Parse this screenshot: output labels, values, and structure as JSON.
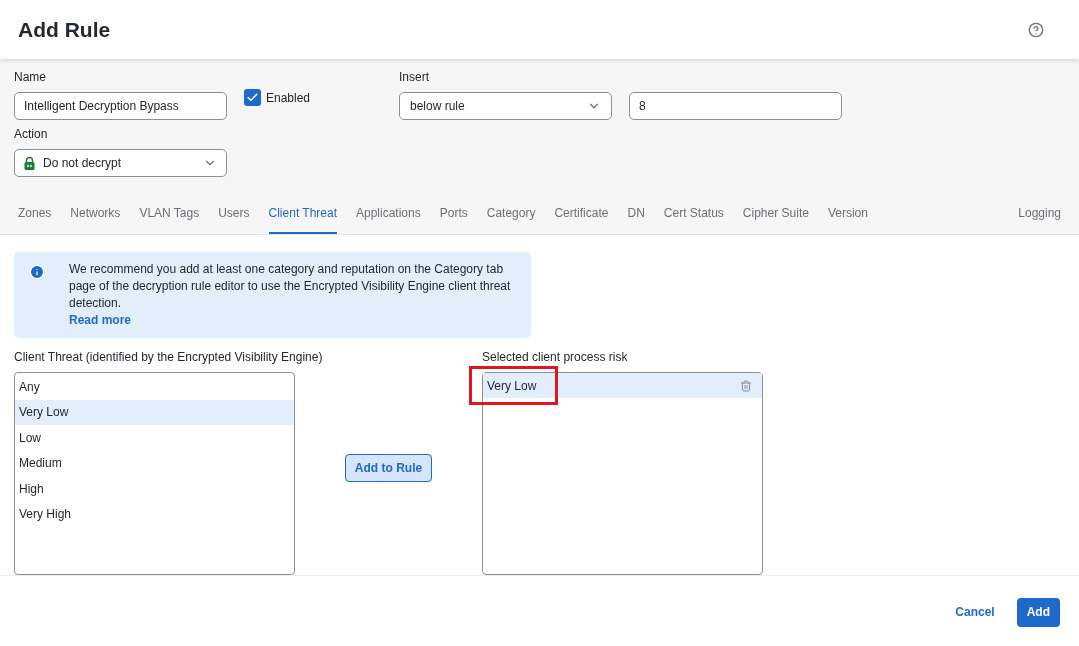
{
  "dialog": {
    "title": "Add Rule"
  },
  "form": {
    "name_label": "Name",
    "name_value": "Intelligent Decryption Bypass",
    "enabled_label": "Enabled",
    "enabled": true,
    "insert_label": "Insert",
    "insert_value": "below rule",
    "insert_number": "8",
    "action_label": "Action",
    "action_value": "Do not decrypt"
  },
  "tabs": [
    {
      "label": "Zones",
      "selected": false
    },
    {
      "label": "Networks",
      "selected": false
    },
    {
      "label": "VLAN Tags",
      "selected": false
    },
    {
      "label": "Users",
      "selected": false
    },
    {
      "label": "Client Threat",
      "selected": true
    },
    {
      "label": "Applications",
      "selected": false
    },
    {
      "label": "Ports",
      "selected": false
    },
    {
      "label": "Category",
      "selected": false
    },
    {
      "label": "Certificate",
      "selected": false
    },
    {
      "label": "DN",
      "selected": false
    },
    {
      "label": "Cert Status",
      "selected": false
    },
    {
      "label": "Cipher Suite",
      "selected": false
    },
    {
      "label": "Version",
      "selected": false
    }
  ],
  "logging_tab": {
    "label": "Logging",
    "selected": false
  },
  "info": {
    "text": "We recommend you add at least one category and reputation on the Category tab page of the decryption rule editor to use the Encrypted Visibility Engine client threat detection.",
    "link": "Read more"
  },
  "available": {
    "label": "Client Threat (identified by the Encrypted Visibility Engine)",
    "items": [
      {
        "label": "Any",
        "selected": false
      },
      {
        "label": "Very Low",
        "selected": true
      },
      {
        "label": "Low",
        "selected": false
      },
      {
        "label": "Medium",
        "selected": false
      },
      {
        "label": "High",
        "selected": false
      },
      {
        "label": "Very High",
        "selected": false
      }
    ]
  },
  "add_button": "Add to Rule",
  "selected_list": {
    "label": "Selected client process risk",
    "items": [
      {
        "label": "Very Low",
        "highlighted": true
      }
    ]
  },
  "footer": {
    "cancel": "Cancel",
    "add": "Add"
  }
}
